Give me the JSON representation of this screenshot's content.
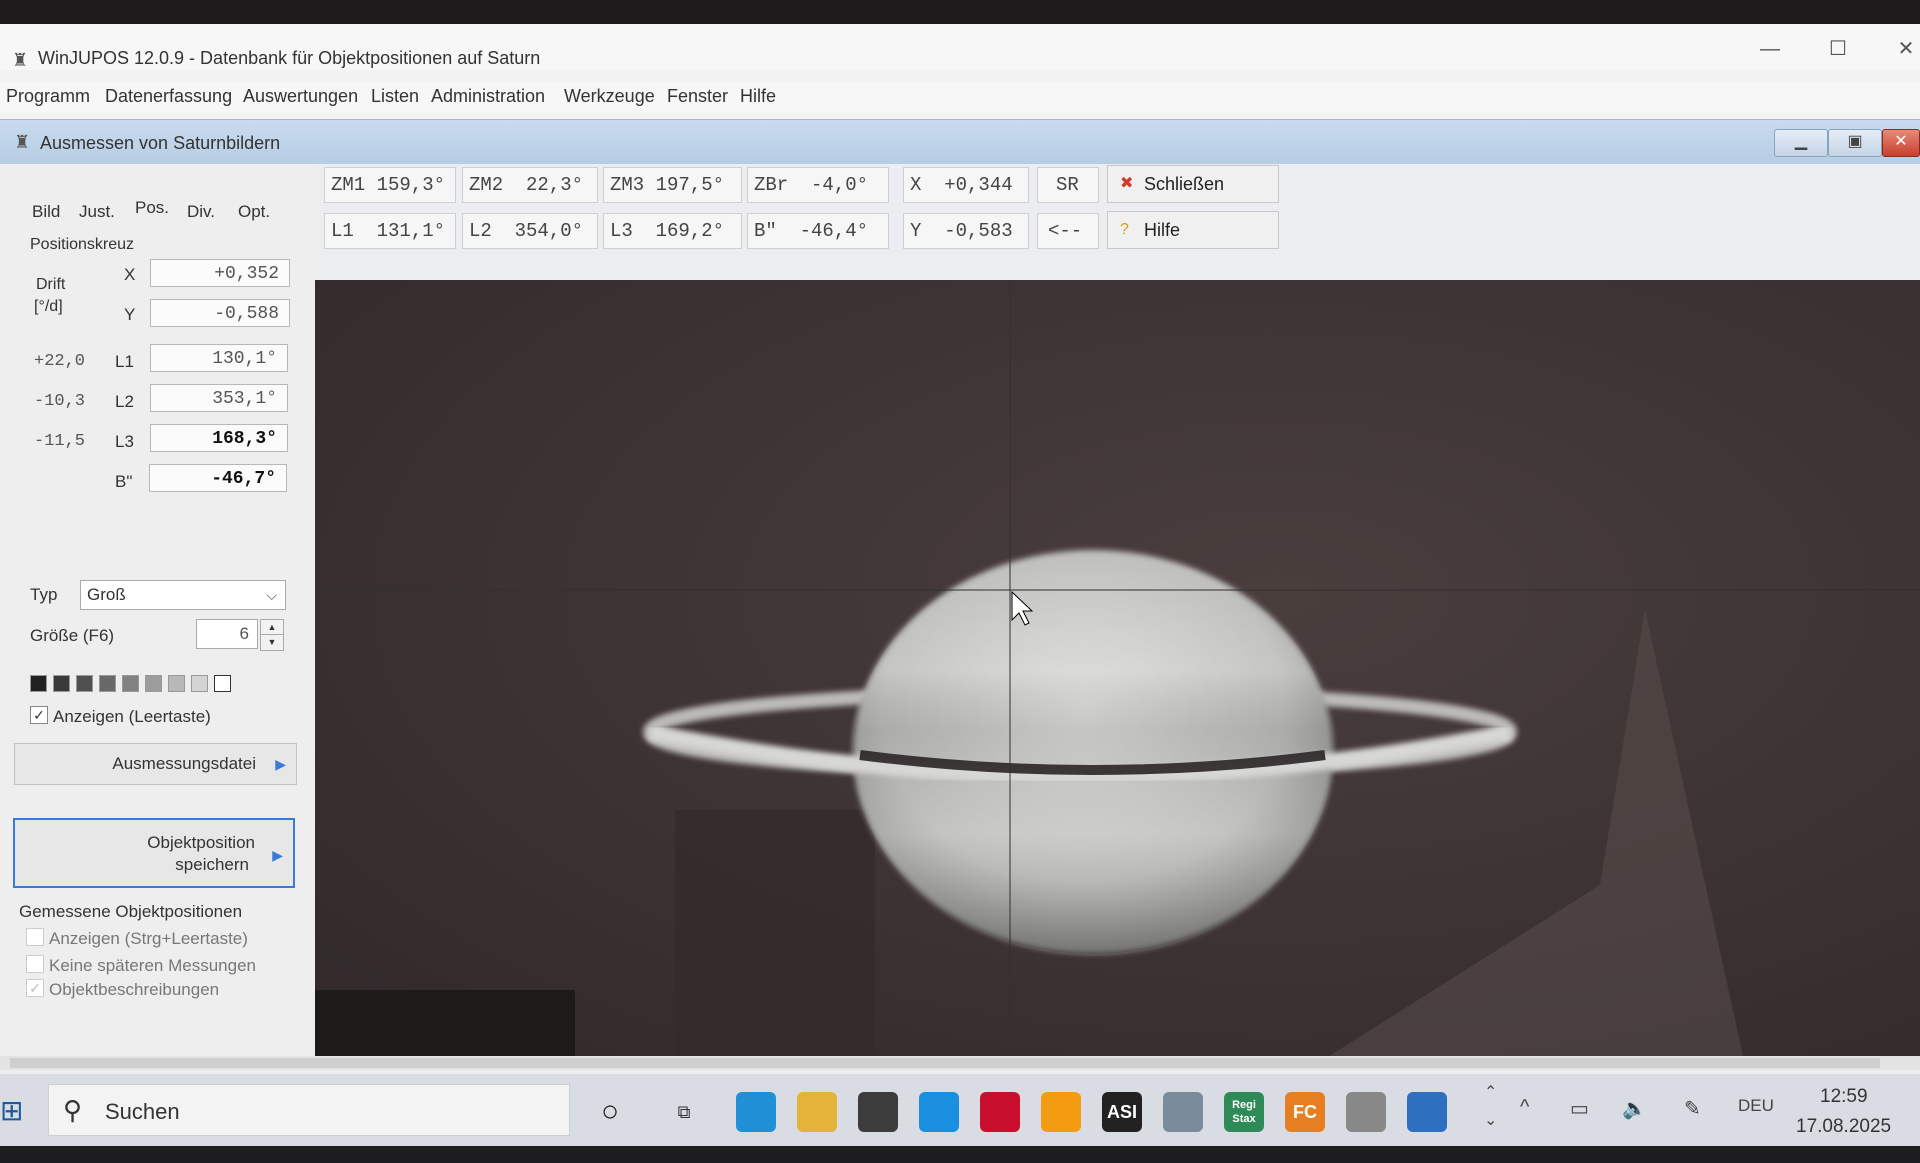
{
  "main_window": {
    "title": "WinJUPOS 12.0.9 - Datenbank für Objektpositionen auf Saturn",
    "menu": [
      "Programm",
      "Datenerfassung",
      "Auswertungen",
      "Listen",
      "Administration",
      "Werkzeuge",
      "Fenster",
      "Hilfe"
    ]
  },
  "child_window": {
    "title": "Ausmessen von Saturnbildern"
  },
  "tabs": [
    "Bild",
    "Just.",
    "Pos.",
    "Div.",
    "Opt."
  ],
  "active_tab": "Pos.",
  "positionskreuz": {
    "group_label": "Positionskreuz",
    "drift_label": "Drift",
    "drift_unit": "[°/d]",
    "rows": [
      {
        "label": "X",
        "value": "+0,352"
      },
      {
        "label": "Y",
        "value": "-0,588"
      },
      {
        "label": "L1",
        "drift": "+22,0",
        "value": "130,1°"
      },
      {
        "label": "L2",
        "drift": "-10,3",
        "value": "353,1°"
      },
      {
        "label": "L3",
        "drift": "-11,5",
        "value": "168,3°"
      },
      {
        "label": "B\"",
        "value": "-46,7°"
      }
    ]
  },
  "typ": {
    "label": "Typ",
    "selected": "Groß"
  },
  "groesse": {
    "label": "Größe (F6)",
    "value": "6"
  },
  "swatch_colors": [
    "#222222",
    "#3a3a3a",
    "#505050",
    "#686868",
    "#828282",
    "#9c9c9c",
    "#b8b8b8",
    "#d4d4d4",
    "#ffffff"
  ],
  "anzeigen": {
    "label": "Anzeigen (Leertaste)",
    "checked": true
  },
  "ausmessungsdatei_label": "Ausmessungsdatei",
  "objektposition_label_line1": "Objektposition",
  "objektposition_label_line2": "speichern",
  "gemessene": {
    "label": "Gemessene Objektpositionen",
    "items": [
      {
        "label": "Anzeigen (Strg+Leertaste)",
        "checked": false
      },
      {
        "label": "Keine späteren Messungen",
        "checked": false
      },
      {
        "label": "Objektbeschreibungen",
        "checked": true
      }
    ]
  },
  "readouts_row1": [
    "ZM1 159,3°",
    "ZM2  22,3°",
    "ZM3 197,5°",
    "ZBr  -4,0°",
    "X  +0,344",
    "SR"
  ],
  "readouts_row2": [
    "L1  131,1°",
    "L2  354,0°",
    "L3  169,2°",
    "B\"  -46,4°",
    "Y  -0,583",
    "<--"
  ],
  "schliessen_label": "Schließen",
  "hilfe_label": "Hilfe",
  "taskbar": {
    "search_placeholder": "Suchen",
    "apps": [
      {
        "name": "edge",
        "color": "#1f8fd6",
        "text": ""
      },
      {
        "name": "explorer",
        "color": "#e3b33a",
        "text": ""
      },
      {
        "name": "mail",
        "color": "#3c3c3c",
        "text": ""
      },
      {
        "name": "store",
        "color": "#1a8fe0",
        "text": ""
      },
      {
        "name": "mcafee",
        "color": "#c8102e",
        "text": ""
      },
      {
        "name": "player",
        "color": "#f39c12",
        "text": ""
      },
      {
        "name": "asi",
        "color": "#222222",
        "text": "ASI"
      },
      {
        "name": "winjupos",
        "color": "#7a8b9c",
        "text": ""
      },
      {
        "name": "registax",
        "color": "#2e8b57",
        "text": "Regi Stax"
      },
      {
        "name": "firecapture",
        "color": "#e67e22",
        "text": "FC"
      },
      {
        "name": "autostakkert",
        "color": "#888888",
        "text": ""
      },
      {
        "name": "app-blue",
        "color": "#2f6fbf",
        "text": ""
      }
    ],
    "language": "DEU",
    "time": "12:59",
    "date": "17.08.2025"
  }
}
